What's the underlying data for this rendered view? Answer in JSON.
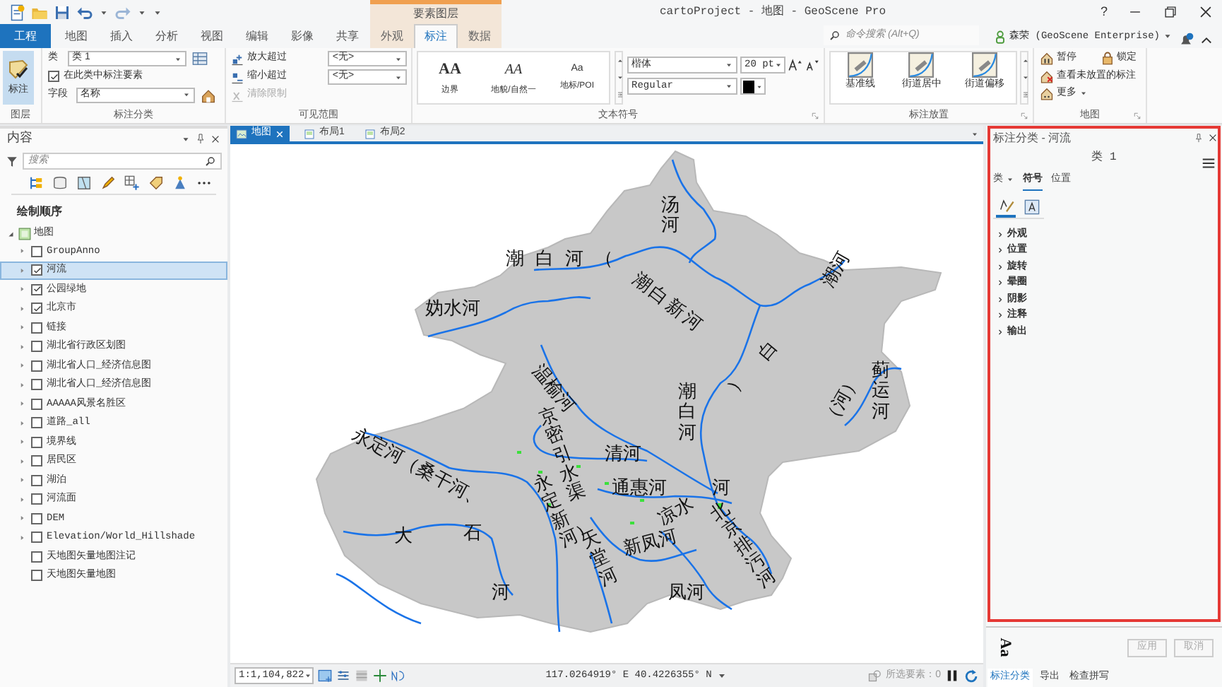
{
  "window": {
    "title": "cartoProject - 地图 - GeoScene Pro",
    "context_group": "要素图层",
    "help": "?"
  },
  "ribbon_tabs": [
    {
      "label": "工程",
      "kind": "file",
      "selected": false
    },
    {
      "label": "地图",
      "kind": "normal",
      "selected": false
    },
    {
      "label": "插入",
      "kind": "normal",
      "selected": false
    },
    {
      "label": "分析",
      "kind": "normal",
      "selected": false
    },
    {
      "label": "视图",
      "kind": "normal",
      "selected": false
    },
    {
      "label": "编辑",
      "kind": "normal",
      "selected": false
    },
    {
      "label": "影像",
      "kind": "normal",
      "selected": false
    },
    {
      "label": "共享",
      "kind": "normal",
      "selected": false
    },
    {
      "label": "外观",
      "kind": "contextual",
      "selected": false
    },
    {
      "label": "标注",
      "kind": "contextual",
      "selected": true
    },
    {
      "label": "数据",
      "kind": "contextual",
      "selected": false
    }
  ],
  "command_search": {
    "placeholder": "命令搜索 (Alt+Q)"
  },
  "user": "森荣 (GeoScene Enterprise)",
  "ribbon_groups": {
    "layer": {
      "title": "图层",
      "button": {
        "label": "标注",
        "selected": true
      }
    },
    "label_class": {
      "title": "标注分类",
      "class_label": "类",
      "class_value": "类 1",
      "label_features": {
        "label": "在此类中标注要素",
        "checked": true
      },
      "field_label": "字段",
      "field_value": "名称"
    },
    "visible_range": {
      "title": "可见范围",
      "items": [
        {
          "label": "放大超过",
          "value": "<无>",
          "disabled": false
        },
        {
          "label": "缩小超过",
          "value": "<无>",
          "disabled": false
        },
        {
          "label": "清除限制",
          "disabled": true
        }
      ]
    },
    "text_symbol": {
      "title": "文本符号",
      "gallery": [
        {
          "sample": "AA",
          "label": "边界"
        },
        {
          "sample": "AA",
          "label": "地貌/自然一"
        },
        {
          "sample": "Aa",
          "label": "地标/POI"
        }
      ],
      "font": "楷体",
      "size": "20 pt",
      "style": "Regular"
    },
    "placement": {
      "title": "标注放置",
      "gallery": [
        "基准线",
        "街道居中",
        "街道偏移"
      ]
    },
    "map": {
      "title": "地图",
      "items": [
        "暂停",
        "锁定",
        "查看未放置的标注",
        "更多"
      ]
    }
  },
  "contents": {
    "title": "内容",
    "search_placeholder": "搜索",
    "heading": "绘制顺序",
    "map": {
      "label": "地图",
      "expanded": true
    },
    "layers": [
      {
        "label": "GroupAnno",
        "checked": false,
        "selected": false,
        "expandable": true
      },
      {
        "label": "河流",
        "checked": true,
        "selected": true,
        "expandable": true
      },
      {
        "label": "公园绿地",
        "checked": true,
        "selected": false,
        "expandable": true
      },
      {
        "label": "北京市",
        "checked": true,
        "selected": false,
        "expandable": true
      },
      {
        "label": "链接",
        "checked": false,
        "selected": false,
        "expandable": true
      },
      {
        "label": "湖北省行政区划图",
        "checked": false,
        "selected": false,
        "expandable": true
      },
      {
        "label": "湖北省人口_经济信息图",
        "checked": false,
        "selected": false,
        "expandable": true
      },
      {
        "label": "湖北省人口_经济信息图",
        "checked": false,
        "selected": false,
        "expandable": true
      },
      {
        "label": "AAAAA风景名胜区",
        "checked": false,
        "selected": false,
        "expandable": true
      },
      {
        "label": "道路_all",
        "checked": false,
        "selected": false,
        "expandable": true
      },
      {
        "label": "境界线",
        "checked": false,
        "selected": false,
        "expandable": true
      },
      {
        "label": "居民区",
        "checked": false,
        "selected": false,
        "expandable": true
      },
      {
        "label": "湖泊",
        "checked": false,
        "selected": false,
        "expandable": true
      },
      {
        "label": "河流面",
        "checked": false,
        "selected": false,
        "expandable": true
      },
      {
        "label": "DEM",
        "checked": false,
        "selected": false,
        "expandable": true
      },
      {
        "label": "Elevation/World_Hillshade",
        "checked": false,
        "selected": false,
        "expandable": true
      },
      {
        "label": "天地图矢量地图注记",
        "checked": false,
        "selected": false,
        "expandable": false
      },
      {
        "label": "天地图矢量地图",
        "checked": false,
        "selected": false,
        "expandable": false
      }
    ]
  },
  "map_tabs": [
    {
      "label": "地图",
      "selected": true
    },
    {
      "label": "布局1",
      "selected": false
    },
    {
      "label": "布局2",
      "selected": false
    }
  ],
  "map_labels": [
    "汤河",
    "潮白河（",
    "潮白新河",
    "潮河",
    "妫水河",
    "温榆河",
    "白",
    "）",
    "潮白河",
    "蓟运河",
    "（河）",
    "京密引水渠",
    "清河",
    "通惠河",
    "永定河（桑干河、",
    "永定新河）",
    "大",
    "石",
    "河",
    "天堂河",
    "凉水",
    "新凤河",
    "河",
    "北京排污河",
    "凤河"
  ],
  "status_bar": {
    "scale": "1:1,104,822",
    "coordinates": "117.0264919° E 40.4226355° N",
    "selected_features": "所选要素：0"
  },
  "label_panel": {
    "title": "标注分类 - 河流",
    "class_name": "类 1",
    "tabs": [
      {
        "label": "类",
        "kind": "dropdown",
        "selected": false
      },
      {
        "label": "符号",
        "kind": "tab",
        "selected": true
      },
      {
        "label": "位置",
        "kind": "tab",
        "selected": false
      }
    ],
    "subtabs": [
      {
        "selected": true
      },
      {
        "selected": false
      }
    ],
    "sections": [
      "外观",
      "位置",
      "旋转",
      "晕圈",
      "阴影",
      "注释",
      "输出"
    ],
    "preview": "Aa",
    "buttons": [
      {
        "label": "应用",
        "disabled": true
      },
      {
        "label": "取消",
        "disabled": true
      }
    ],
    "bottom_tabs": [
      {
        "label": "标注分类",
        "selected": true
      },
      {
        "label": "导出",
        "selected": false
      },
      {
        "label": "检查拼写",
        "selected": false
      }
    ]
  }
}
